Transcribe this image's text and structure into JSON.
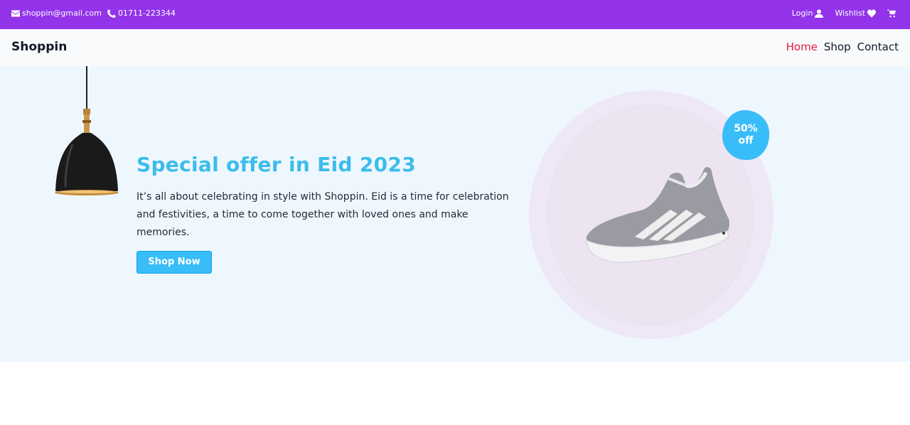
{
  "topbar": {
    "email": "shoppin@gmail.com",
    "phone": "01711-223344",
    "login_label": "Login",
    "wishlist_label": "Wishlist",
    "icons": {
      "email": "envelope-icon",
      "phone": "phone-icon",
      "login": "user-icon",
      "wishlist": "heart-icon",
      "cart": "cart-icon"
    },
    "bg_color": "#9333ea"
  },
  "navbar": {
    "brand": "Shoppin",
    "links": [
      {
        "label": "Home",
        "active": true
      },
      {
        "label": "Shop",
        "active": false
      },
      {
        "label": "Contact",
        "active": false
      }
    ],
    "active_color": "#e11d48"
  },
  "hero": {
    "title": "Special offer in Eid 2023",
    "description": "It’s all about celebrating in style with Shoppin. Eid is a time for celebration and festivities, a time to come together with loved ones and make memories.",
    "button_label": "Shop Now",
    "badge_line1": "50%",
    "badge_line2": "off",
    "accent_color": "#38bdf8"
  }
}
